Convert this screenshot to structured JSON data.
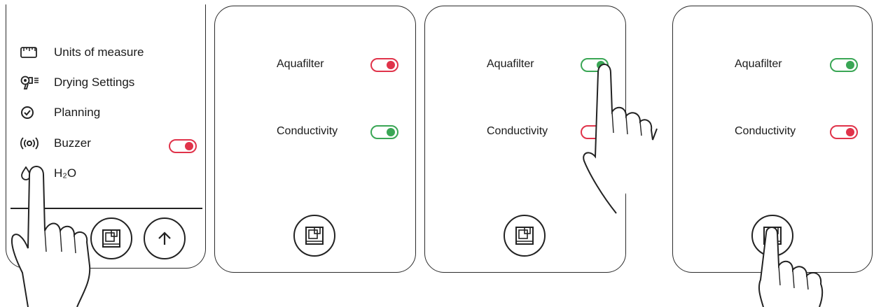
{
  "panel1": {
    "menu": [
      {
        "label": "Units of measure",
        "icon": "ruler-icon"
      },
      {
        "label": "Drying Settings",
        "icon": "hair-dryer-icon"
      },
      {
        "label": "Planning",
        "icon": "clock-check-icon"
      },
      {
        "label": "Buzzer",
        "icon": "buzzer-icon",
        "toggle": "on",
        "toggle_color": "#e0334a"
      },
      {
        "label": "H₂O",
        "icon": "water-drop-icon"
      }
    ],
    "buttons": [
      "save-icon",
      "arrow-up-icon"
    ]
  },
  "panel2": {
    "rows": [
      {
        "label": "Aquafilter",
        "state": "on",
        "color": "#e0334a"
      },
      {
        "label": "Conductivity",
        "state": "on",
        "color": "#3aa655"
      }
    ],
    "button": "save-icon"
  },
  "panel3": {
    "rows": [
      {
        "label": "Aquafilter",
        "state": "on",
        "color": "#3aa655"
      },
      {
        "label": "Conductivity",
        "state": "on",
        "color": "#e0334a"
      }
    ],
    "button": "save-icon"
  },
  "panel4": {
    "rows": [
      {
        "label": "Aquafilter",
        "state": "on",
        "color": "#3aa655"
      },
      {
        "label": "Conductivity",
        "state": "on",
        "color": "#e0334a"
      }
    ],
    "button": "save-icon"
  },
  "colors": {
    "red": "#e0334a",
    "green": "#3aa655",
    "stroke": "#222222"
  }
}
